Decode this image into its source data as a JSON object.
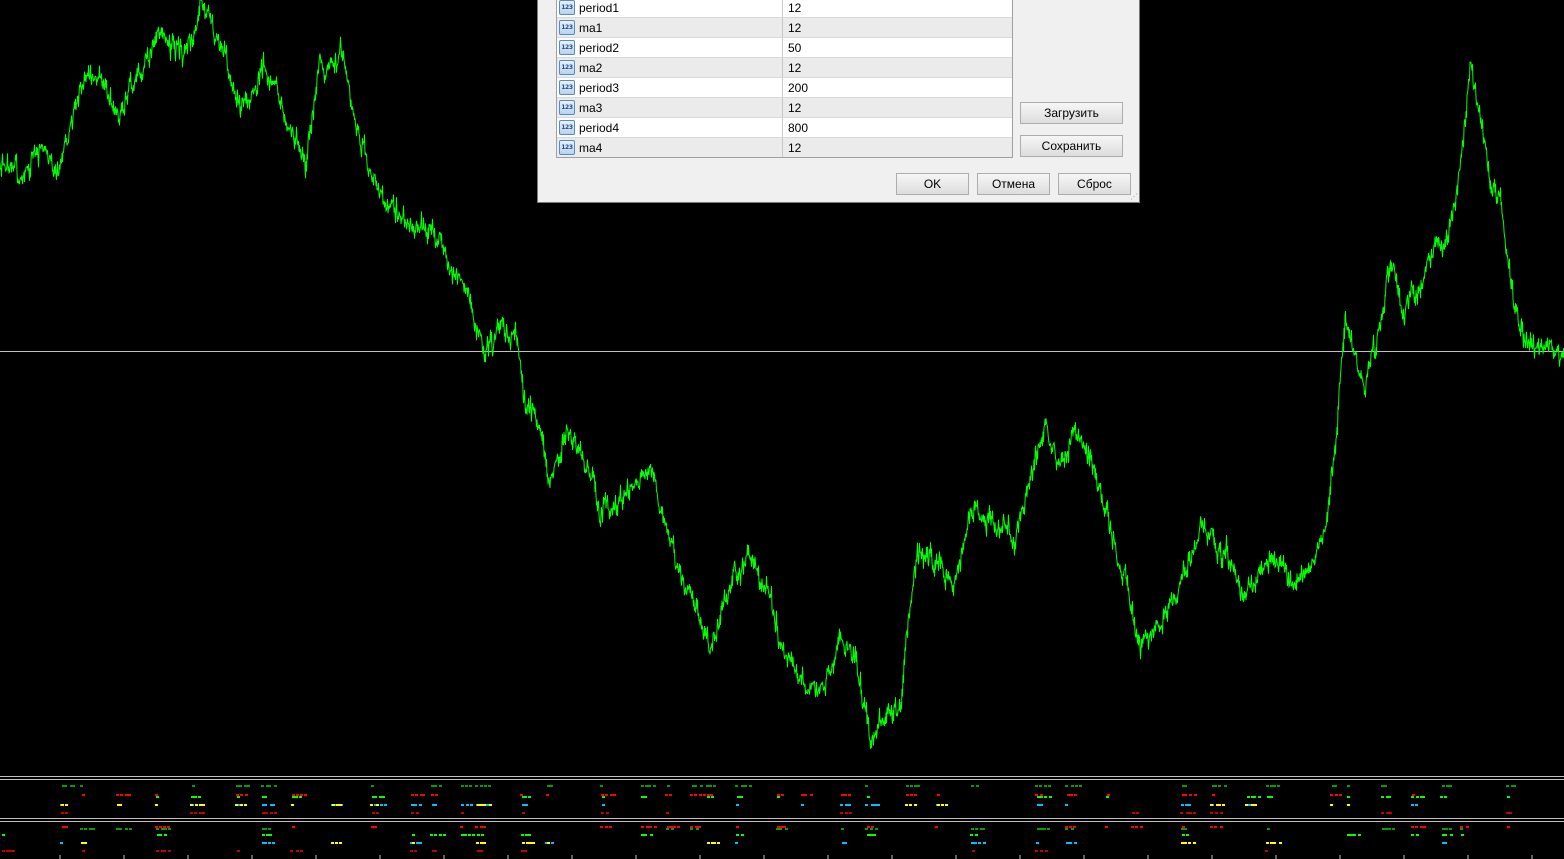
{
  "dialog": {
    "params": [
      {
        "name": "period1",
        "value": "12",
        "icon": "integer-123-icon"
      },
      {
        "name": "ma1",
        "value": "12",
        "icon": "integer-123-icon"
      },
      {
        "name": "period2",
        "value": "50",
        "icon": "integer-123-icon"
      },
      {
        "name": "ma2",
        "value": "12",
        "icon": "integer-123-icon"
      },
      {
        "name": "period3",
        "value": "200",
        "icon": "integer-123-icon"
      },
      {
        "name": "ma3",
        "value": "12",
        "icon": "integer-123-icon"
      },
      {
        "name": "period4",
        "value": "800",
        "icon": "integer-123-icon"
      },
      {
        "name": "ma4",
        "value": "12",
        "icon": "integer-123-icon"
      }
    ],
    "icon_text": "123",
    "load_label": "Загрузить",
    "save_label": "Сохранить",
    "ok_label": "OK",
    "cancel_label": "Отмена",
    "reset_label": "Сброс"
  },
  "chart": {
    "background": "#000000",
    "price_color": "#00ff00",
    "hline_color": "#c0c0c0",
    "separator_color": "#c0c0c0",
    "indicator_colors": [
      "#ff0000",
      "#00ff00",
      "#00bfff",
      "#ffff00",
      "#00a000",
      "#c00000"
    ]
  }
}
